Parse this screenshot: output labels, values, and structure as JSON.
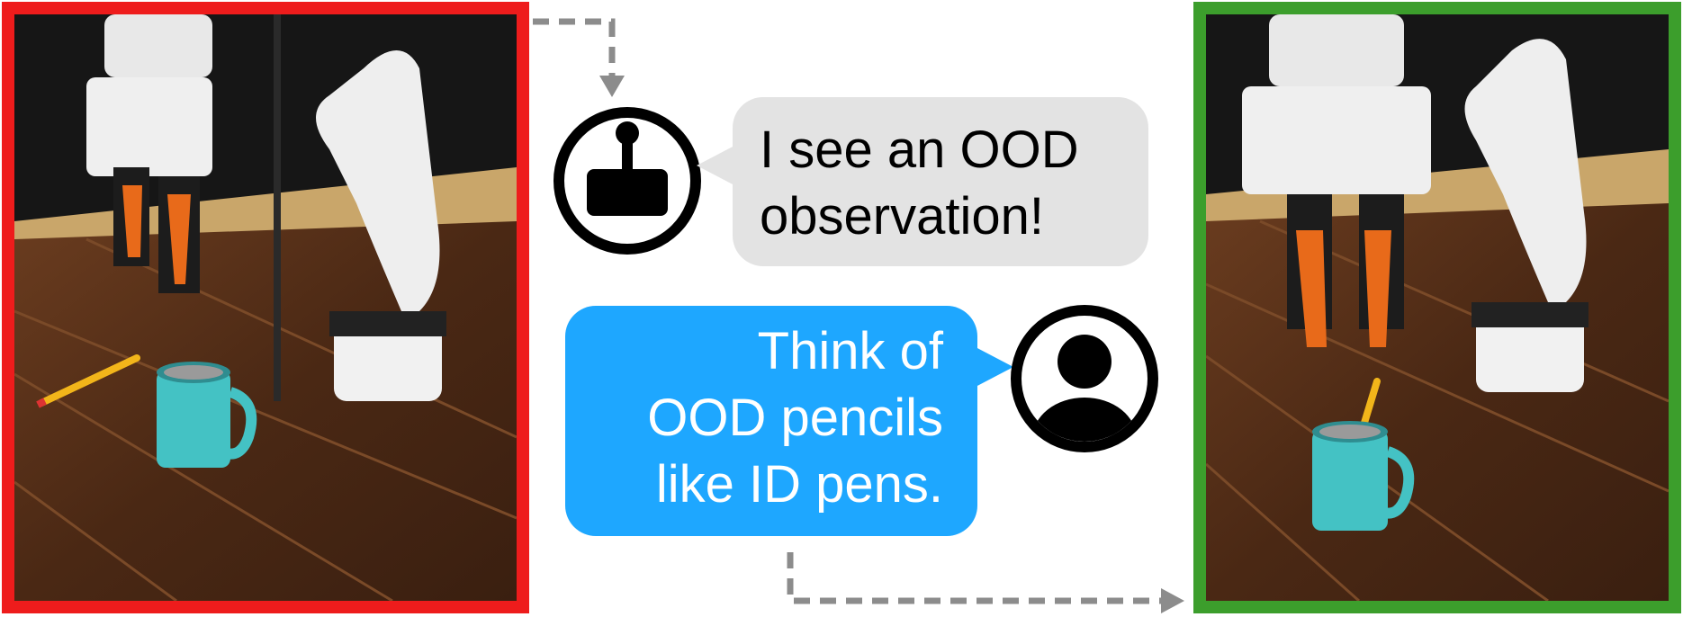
{
  "robot_message": {
    "lines": [
      "I see an OOD",
      "observation!"
    ]
  },
  "human_message": {
    "lines": [
      "Think of",
      "OOD pencils",
      "like ID pens."
    ]
  },
  "colors": {
    "failure_frame": "#ee1c1c",
    "success_frame": "#3c9e2c",
    "robot_bubble": "#e3e3e3",
    "human_bubble": "#1ea7ff",
    "arrow": "#8c8c8c"
  },
  "icons": {
    "robot": "joystick-robot-icon",
    "human": "person-avatar-icon"
  }
}
